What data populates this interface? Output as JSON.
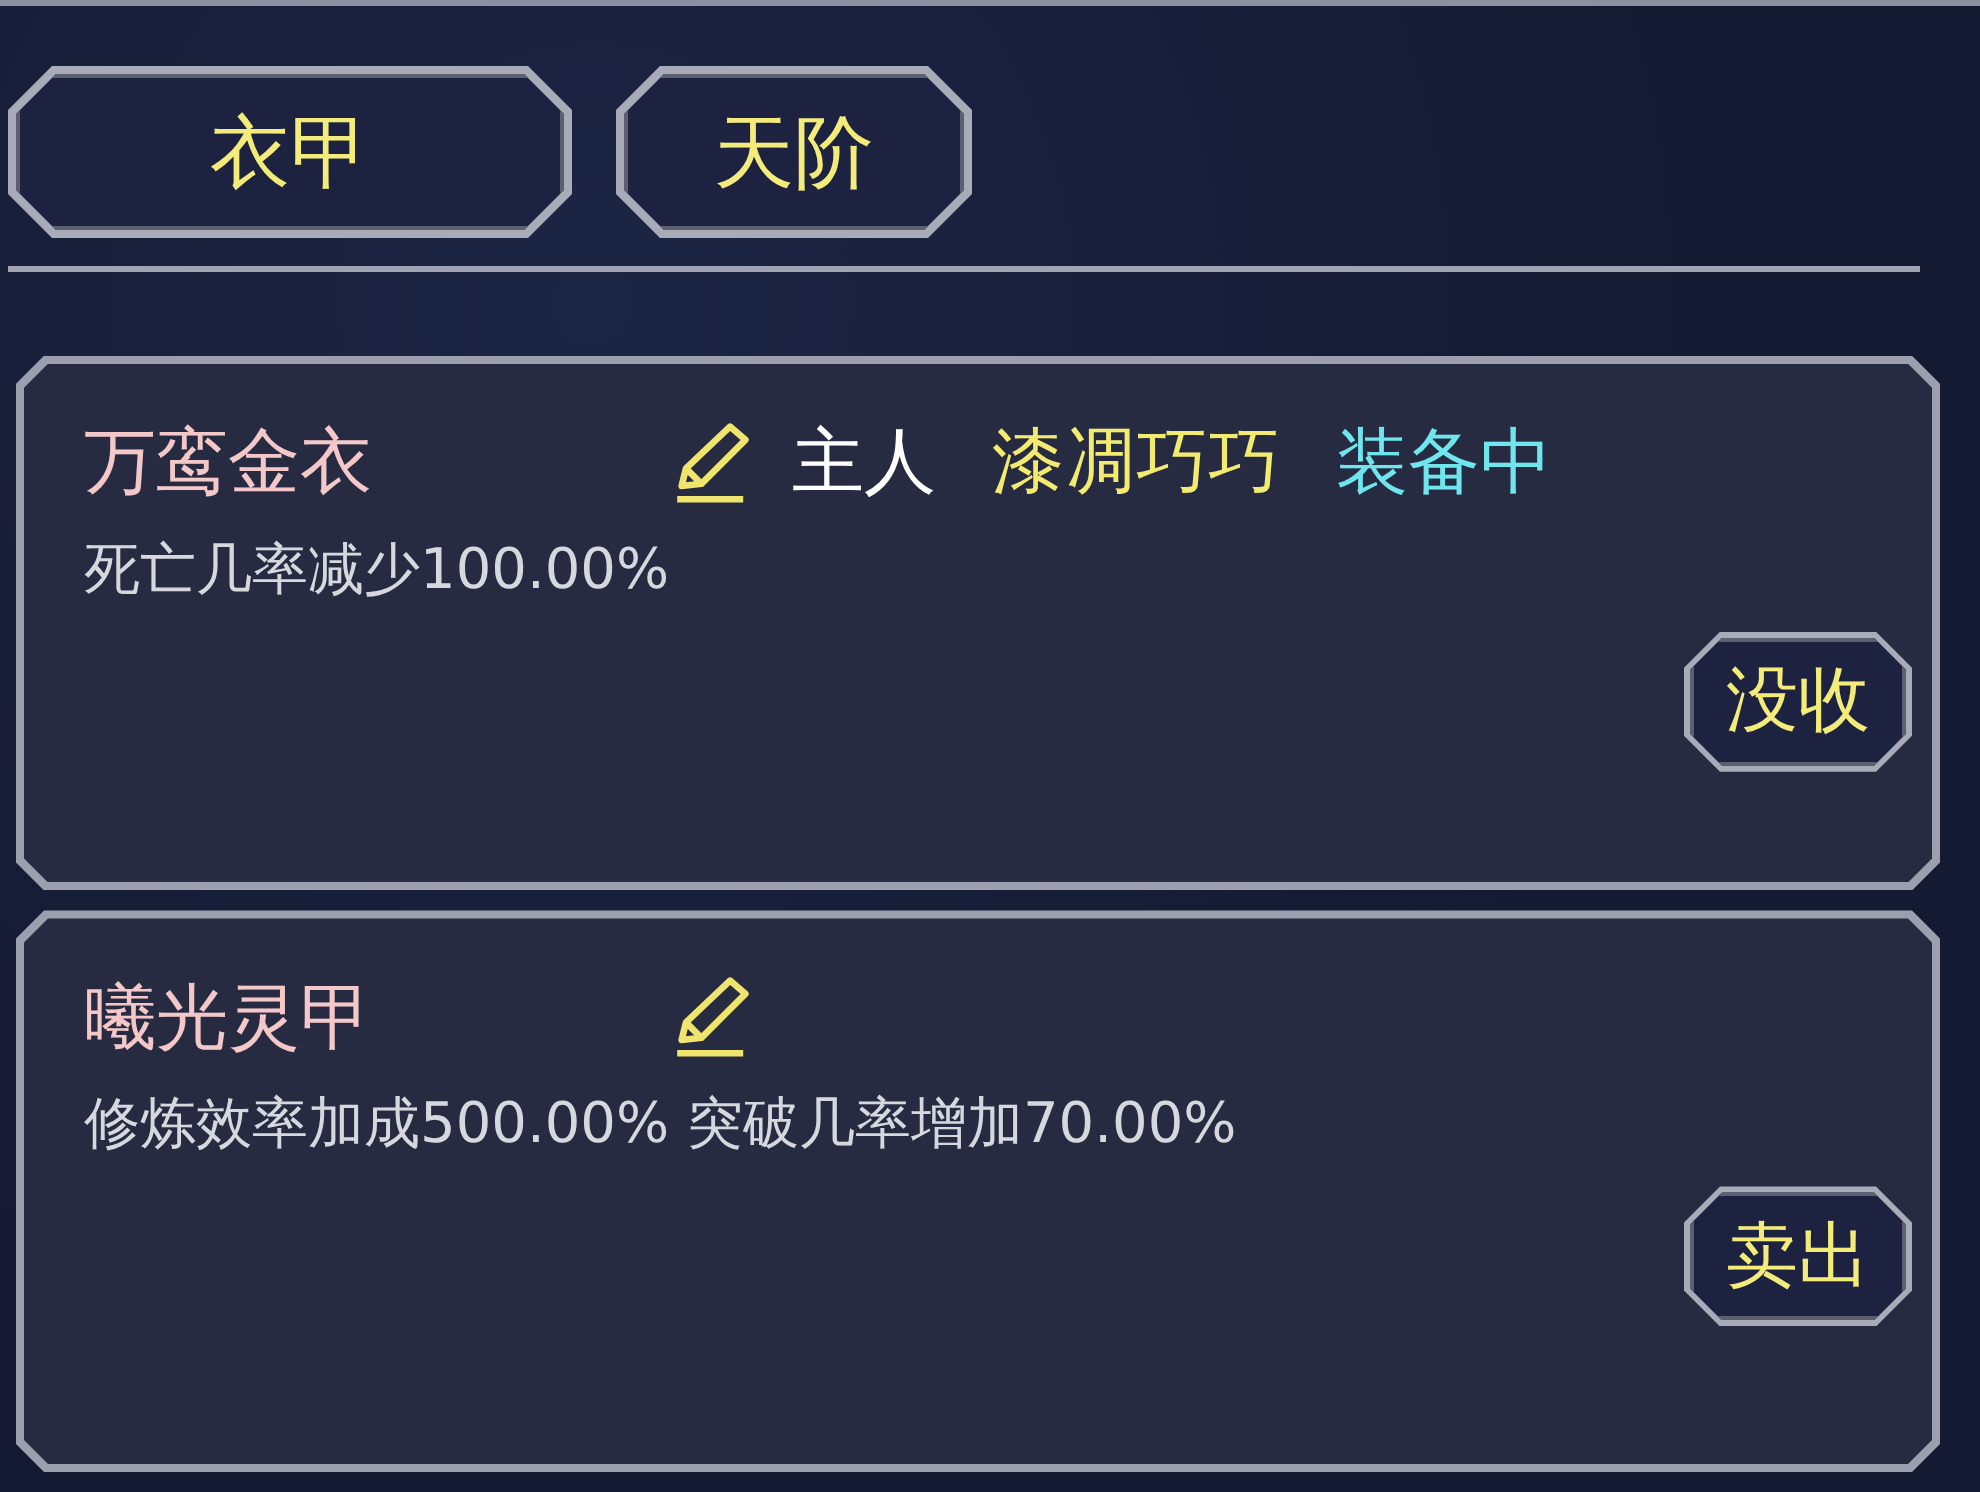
{
  "tabs": [
    {
      "label": "衣甲"
    },
    {
      "label": "天阶"
    }
  ],
  "items": [
    {
      "name": "万鸾金衣",
      "owner_label": "主人",
      "owner_name": "漆凋巧巧",
      "status": "装备中",
      "effects": "死亡几率减少100.00%",
      "action": "没收"
    },
    {
      "name": "曦光灵甲",
      "effects": "修炼效率加成500.00% 突破几率增加70.00%",
      "action": "卖出"
    }
  ]
}
